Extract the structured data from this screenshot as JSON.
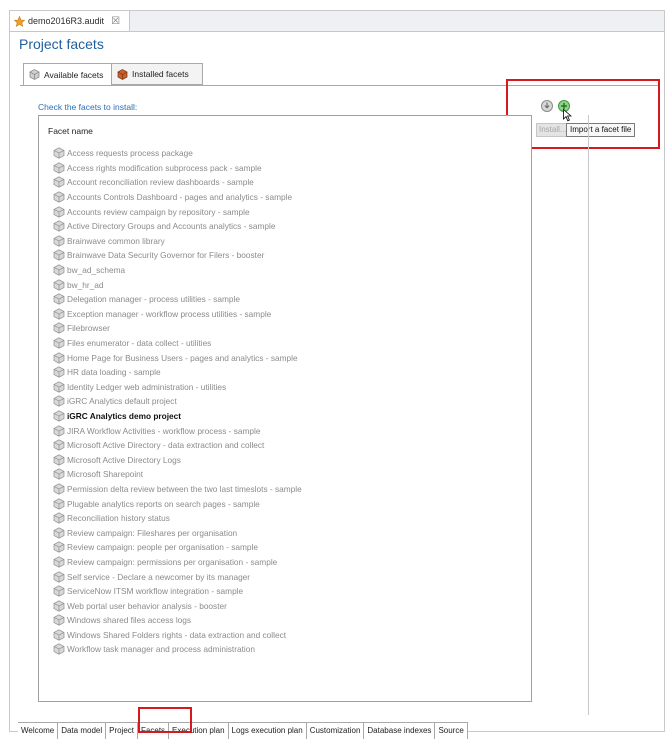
{
  "editor": {
    "file_tab_label": "demo2016R3.audit",
    "file_tab_close": "☒",
    "page_title": "Project facets"
  },
  "facet_tabs": [
    {
      "label": "Available facets",
      "icon": "cube-gray-icon",
      "active": true
    },
    {
      "label": "Installed facets",
      "icon": "cube-orange-icon",
      "active": false
    }
  ],
  "instruction": "Check the facets to install:",
  "toolbar": {
    "install_label": "Install...",
    "tooltip": "Import a facet file",
    "buttons": [
      {
        "name": "install-icon",
        "color": "#9a9a9a"
      },
      {
        "name": "import-facet-icon",
        "color": "#4caf50"
      }
    ]
  },
  "facet_list": {
    "header": "Facet name",
    "items": [
      {
        "label": "Access requests process package",
        "bold": false
      },
      {
        "label": "Access rights modification subprocess pack - sample",
        "bold": false
      },
      {
        "label": "Account reconciliation review dashboards - sample",
        "bold": false
      },
      {
        "label": "Accounts Controls Dashboard - pages and analytics - sample",
        "bold": false
      },
      {
        "label": "Accounts review campaign by repository - sample",
        "bold": false
      },
      {
        "label": "Active Directory Groups and Accounts analytics - sample",
        "bold": false
      },
      {
        "label": "Brainwave common library",
        "bold": false
      },
      {
        "label": "Brainwave Data Security Governor for Filers - booster",
        "bold": false
      },
      {
        "label": "bw_ad_schema",
        "bold": false
      },
      {
        "label": "bw_hr_ad",
        "bold": false
      },
      {
        "label": "Delegation manager - process utilities - sample",
        "bold": false
      },
      {
        "label": "Exception manager - workflow process utilities - sample",
        "bold": false
      },
      {
        "label": "Filebrowser",
        "bold": false
      },
      {
        "label": "Files enumerator - data collect - utilities",
        "bold": false
      },
      {
        "label": "Home Page for Business Users - pages and analytics - sample",
        "bold": false
      },
      {
        "label": "HR data loading - sample",
        "bold": false
      },
      {
        "label": "Identity Ledger web administration - utilities",
        "bold": false
      },
      {
        "label": "iGRC Analytics default project",
        "bold": false
      },
      {
        "label": "iGRC Analytics demo project",
        "bold": true
      },
      {
        "label": "JIRA Workflow Activities -  workflow process - sample",
        "bold": false
      },
      {
        "label": "Microsoft Active Directory - data extraction and collect",
        "bold": false
      },
      {
        "label": "Microsoft Active Directory Logs",
        "bold": false
      },
      {
        "label": "Microsoft Sharepoint",
        "bold": false
      },
      {
        "label": "Permission delta review between the two last timeslots - sample",
        "bold": false
      },
      {
        "label": "Plugable analytics reports on search pages - sample",
        "bold": false
      },
      {
        "label": "Reconciliation history status",
        "bold": false
      },
      {
        "label": "Review campaign: Fileshares per organisation",
        "bold": false
      },
      {
        "label": "Review campaign: people per organisation - sample",
        "bold": false
      },
      {
        "label": "Review campaign: permissions per organisation - sample",
        "bold": false
      },
      {
        "label": "Self service - Declare a newcomer by its manager",
        "bold": false
      },
      {
        "label": "ServiceNow ITSM workflow integration - sample",
        "bold": false
      },
      {
        "label": "Web portal user behavior analysis - booster",
        "bold": false
      },
      {
        "label": "Windows shared files access logs",
        "bold": false
      },
      {
        "label": "Windows Shared Folders rights - data extraction and collect",
        "bold": false
      },
      {
        "label": "Workflow task manager and process administration",
        "bold": false
      }
    ]
  },
  "bottom_tabs": [
    {
      "label": "Welcome",
      "active": false
    },
    {
      "label": "Data model",
      "active": false
    },
    {
      "label": "Project",
      "active": false
    },
    {
      "label": "Facets",
      "active": true
    },
    {
      "label": "Execution plan",
      "active": false
    },
    {
      "label": "Logs execution plan",
      "active": false
    },
    {
      "label": "Customization",
      "active": false
    },
    {
      "label": "Database indexes",
      "active": false
    },
    {
      "label": "Source",
      "active": false
    }
  ],
  "colors": {
    "title_blue": "#1f5f9e",
    "link_blue": "#2c6db6",
    "highlight_red": "#d6191e",
    "disabled_text": "#8b8b8b"
  }
}
